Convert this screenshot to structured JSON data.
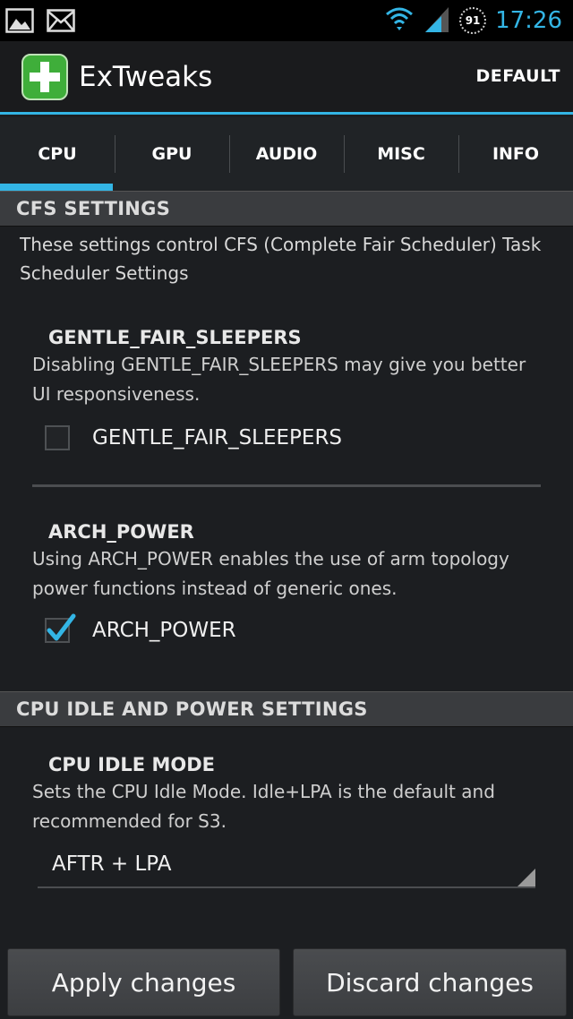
{
  "status_bar": {
    "time": "17:26",
    "battery_level": "91",
    "icons": [
      "image-notification-icon",
      "mail-notification-icon",
      "wifi-icon",
      "cell-signal-icon",
      "battery-icon"
    ]
  },
  "action_bar": {
    "title": "ExTweaks",
    "default_label": "DEFAULT"
  },
  "tabs": [
    {
      "label": "CPU",
      "selected": true
    },
    {
      "label": "GPU",
      "selected": false
    },
    {
      "label": "AUDIO",
      "selected": false
    },
    {
      "label": "MISC",
      "selected": false
    },
    {
      "label": "INFO",
      "selected": false
    }
  ],
  "cfs_section": {
    "header": "CFS SETTINGS",
    "description": "These settings control CFS (Complete Fair Scheduler) Task Scheduler Settings",
    "gentle": {
      "title": "GENTLE_FAIR_SLEEPERS",
      "summary": "Disabling GENTLE_FAIR_SLEEPERS may give you better UI responsiveness.",
      "checkbox_label": "GENTLE_FAIR_SLEEPERS",
      "checked": false
    },
    "arch": {
      "title": "ARCH_POWER",
      "summary": "Using ARCH_POWER enables the use of arm topology power functions instead of generic ones.",
      "checkbox_label": "ARCH_POWER",
      "checked": true
    }
  },
  "idle_section": {
    "header": "CPU IDLE AND POWER SETTINGS",
    "idle_mode": {
      "title": "CPU IDLE MODE",
      "summary": "Sets the CPU Idle Mode. Idle+LPA is the default and recommended for S3.",
      "selected_value": "AFTR + LPA"
    }
  },
  "buttons": {
    "apply": "Apply changes",
    "discard": "Discard changes"
  },
  "colors": {
    "accent": "#33b5e5",
    "background": "#1c1e21",
    "app_icon_green": "#3fae3a"
  }
}
